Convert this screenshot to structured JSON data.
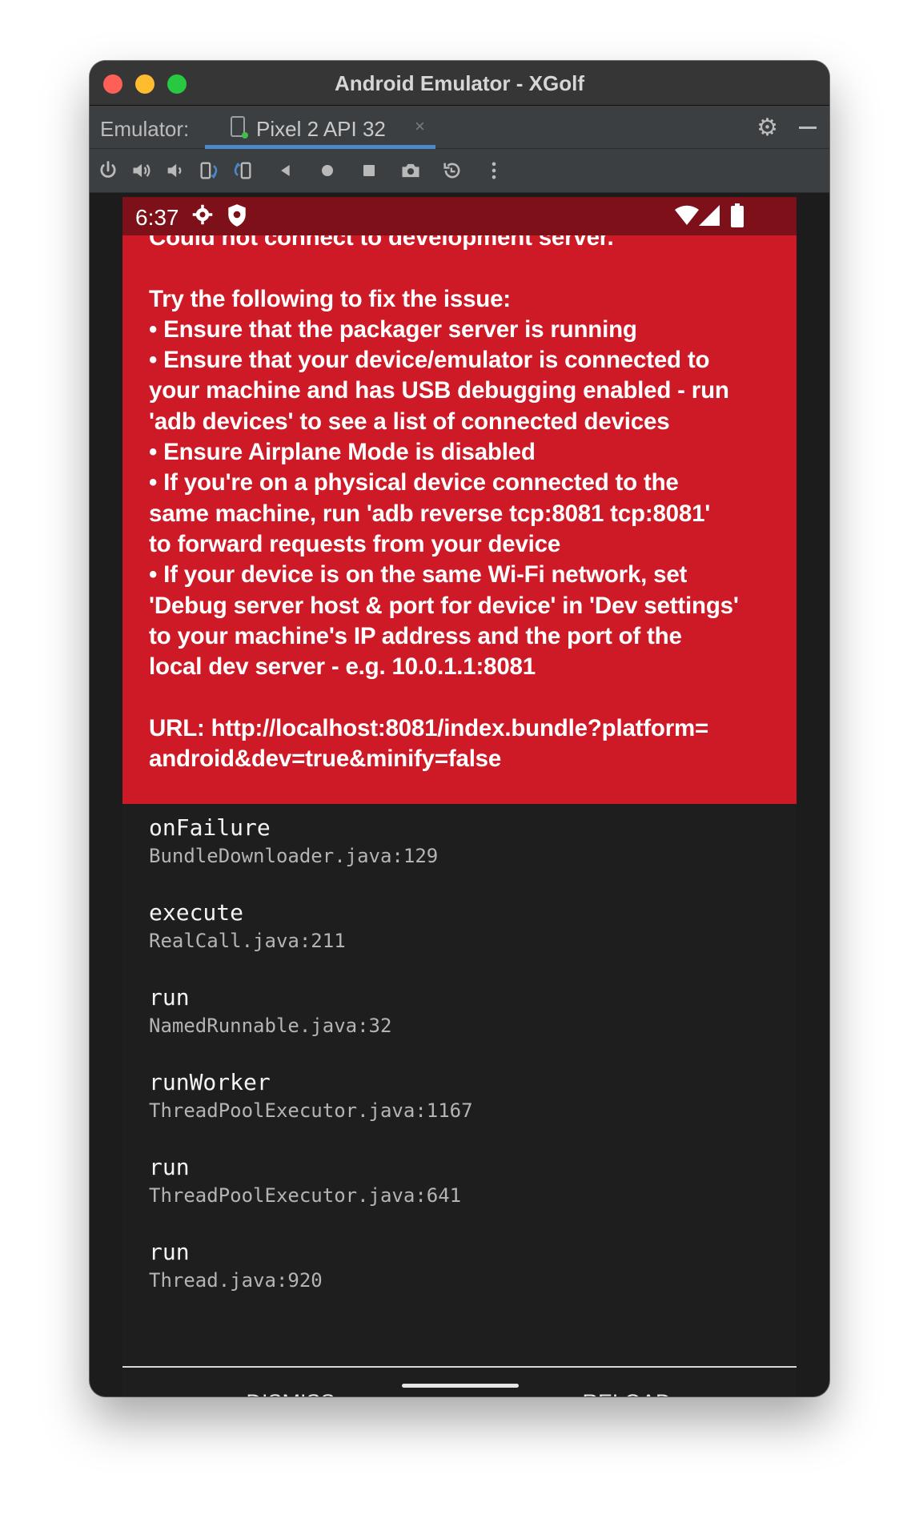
{
  "window": {
    "title": "Android Emulator - XGolf"
  },
  "tabbar": {
    "label": "Emulator:",
    "tab_name": "Pixel 2 API 32",
    "tab_close": "×"
  },
  "toolbar": {
    "icons": [
      "power-icon",
      "volume-up-icon",
      "volume-down-icon",
      "rotate-left-icon",
      "rotate-right-icon",
      "back-icon",
      "home-icon",
      "overview-icon",
      "camera-icon",
      "snapshot-icon",
      "more-icon"
    ]
  },
  "statusbar": {
    "time": "6:37"
  },
  "error": {
    "message": "Could not connect to development server.\n\nTry the following to fix the issue:\n• Ensure that the packager server is running\n• Ensure that your device/emulator is connected to\nyour machine and has USB debugging enabled - run\n'adb devices' to see a list of connected devices\n• Ensure Airplane Mode is disabled\n• If you're on a physical device connected to the\nsame machine, run 'adb reverse tcp:8081 tcp:8081'\nto forward requests from your device\n• If your device is on the same Wi-Fi network, set\n'Debug server host & port for device' in 'Dev settings'\nto your machine's IP address and the port of the\nlocal dev server - e.g. 10.0.1.1:8081\n\nURL: http://localhost:8081/index.bundle?platform=\nandroid&dev=true&minify=false"
  },
  "stack": [
    {
      "method": "onFailure",
      "file": "BundleDownloader.java:129"
    },
    {
      "method": "execute",
      "file": "RealCall.java:211"
    },
    {
      "method": "run",
      "file": "NamedRunnable.java:32"
    },
    {
      "method": "runWorker",
      "file": "ThreadPoolExecutor.java:1167"
    },
    {
      "method": "run",
      "file": "ThreadPoolExecutor.java:641"
    },
    {
      "method": "run",
      "file": "Thread.java:920"
    }
  ],
  "buttons": {
    "dismiss": "DISMISS\n(ESC)",
    "reload": "RELOAD\n(R, R)"
  },
  "colors": {
    "error_red": "#cd1a26",
    "statusbar_red": "#7d1019",
    "stack_bg": "#1e1e1f",
    "tab_underline": "#4a88c7"
  }
}
